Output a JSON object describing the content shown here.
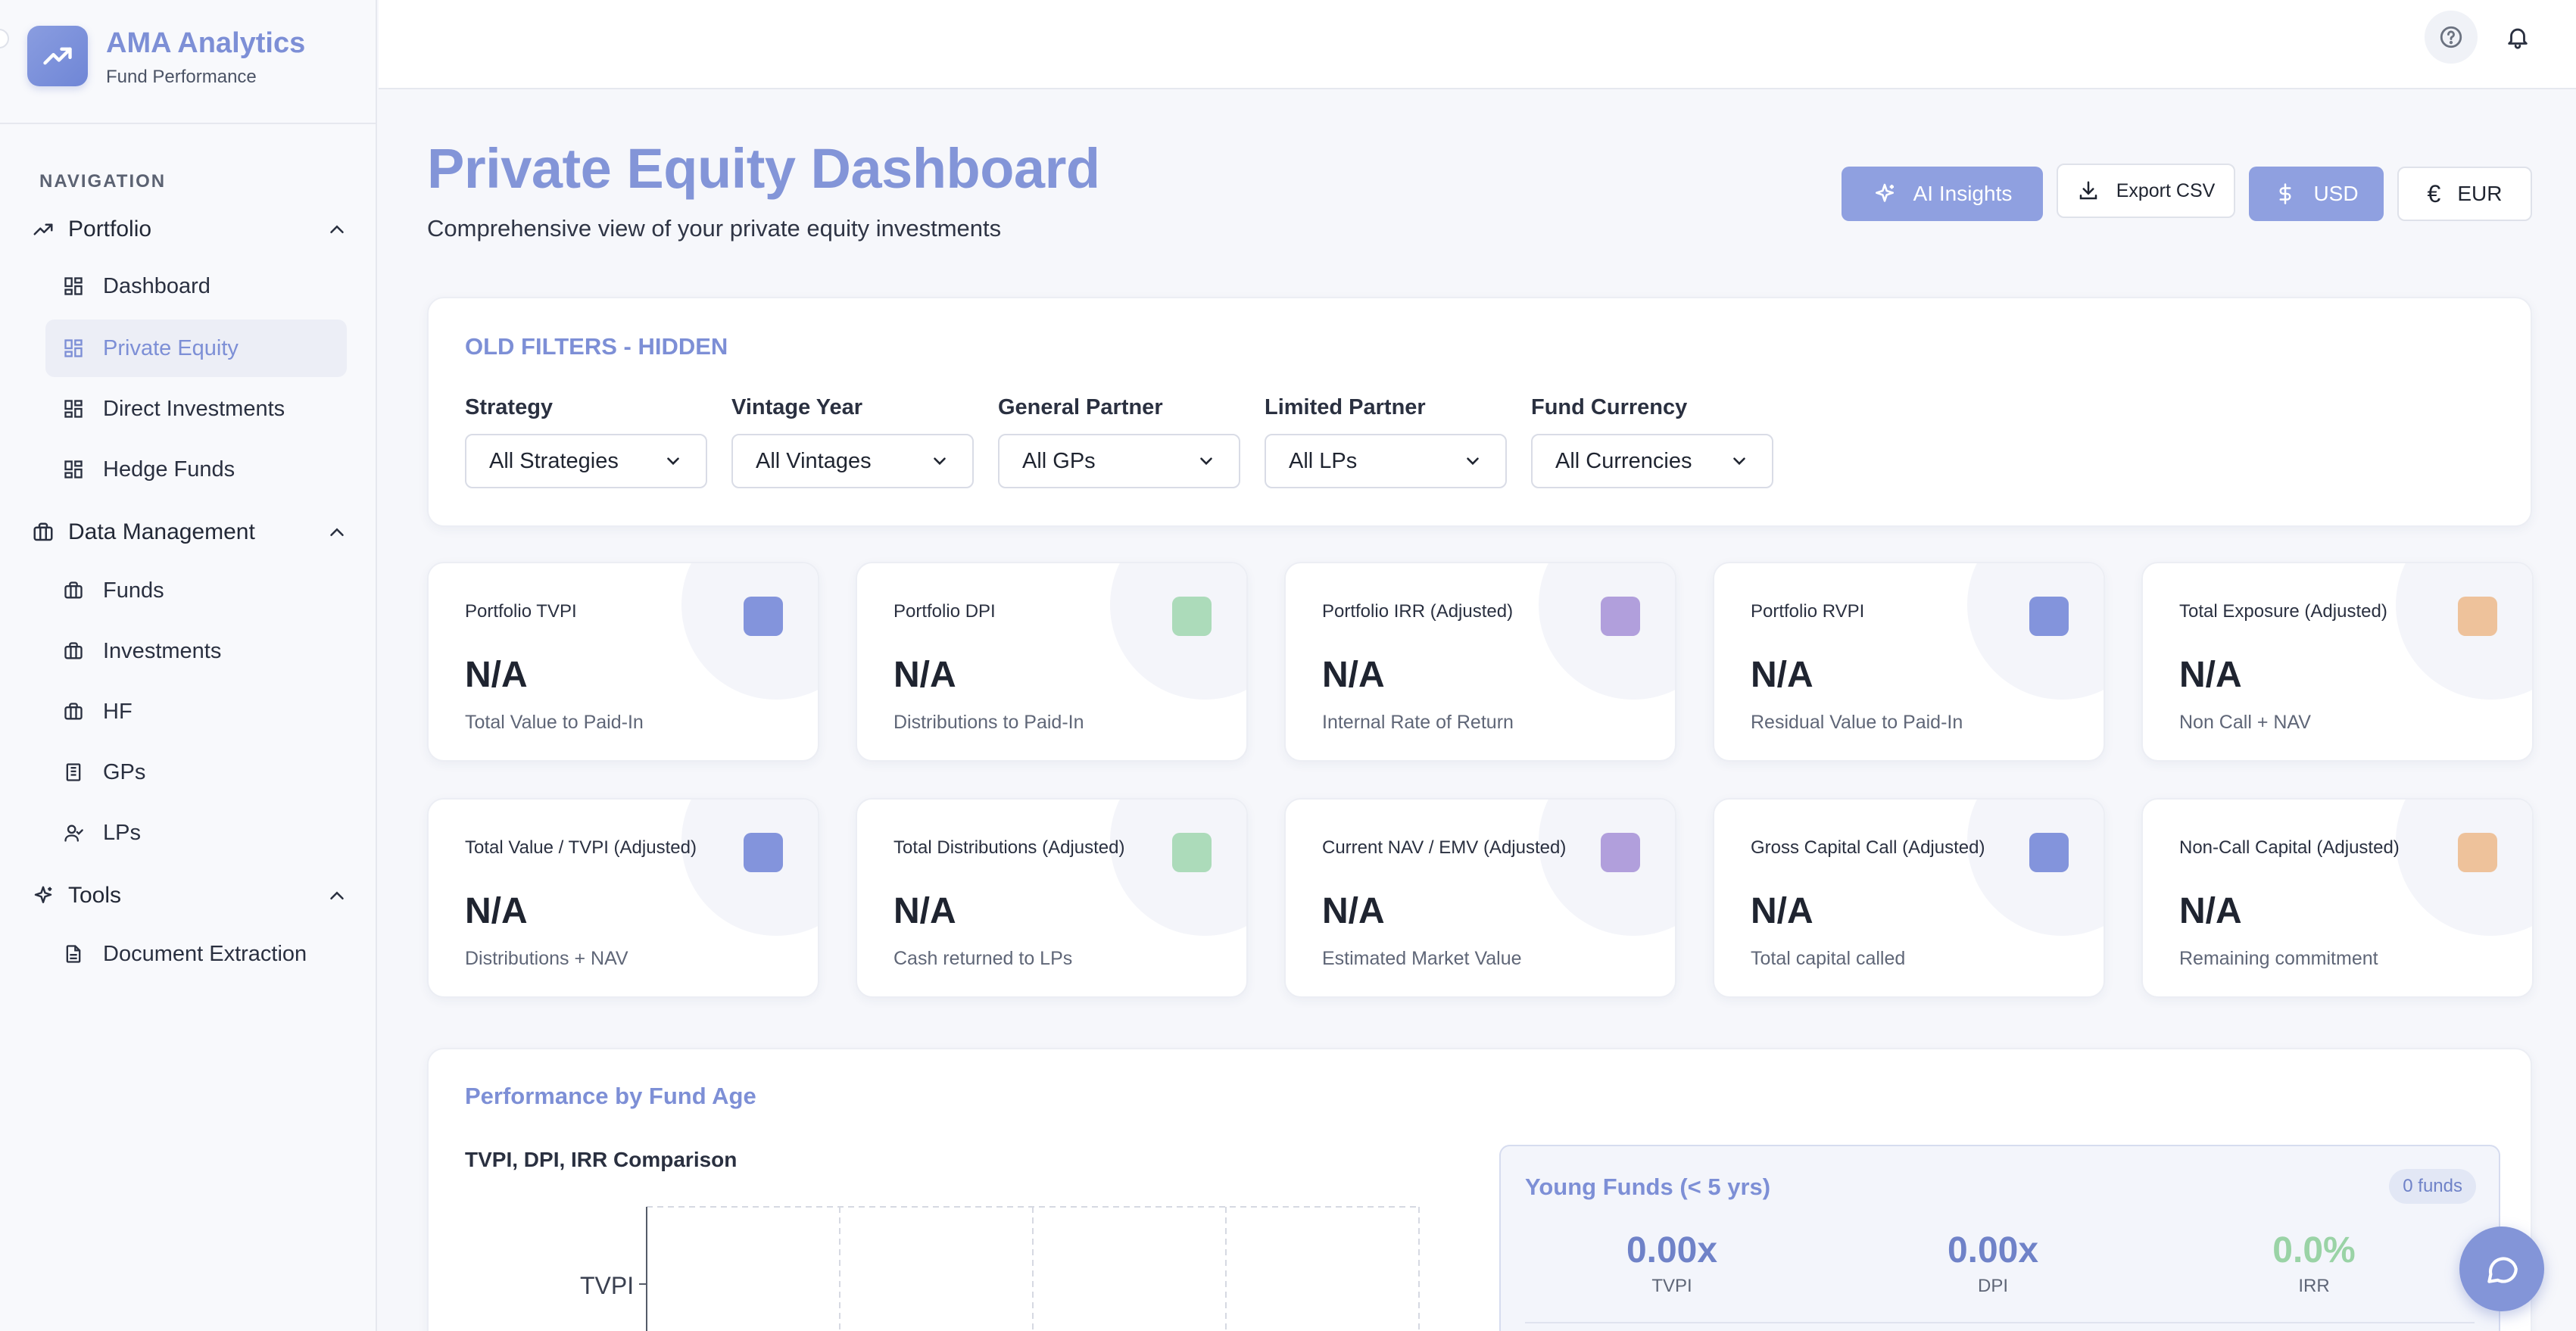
{
  "brand": {
    "title": "AMA Analytics",
    "subtitle": "Fund Performance"
  },
  "sidebar": {
    "nav_heading": "NAVIGATION",
    "groups": [
      {
        "label": "Portfolio",
        "icon": "trending-up-icon",
        "items": [
          {
            "label": "Dashboard",
            "icon": "grid-icon",
            "active": false
          },
          {
            "label": "Private Equity",
            "icon": "grid-icon",
            "active": true
          },
          {
            "label": "Direct Investments",
            "icon": "grid-icon",
            "active": false
          },
          {
            "label": "Hedge Funds",
            "icon": "grid-icon",
            "active": false
          }
        ]
      },
      {
        "label": "Data Management",
        "icon": "briefcase-icon",
        "items": [
          {
            "label": "Funds",
            "icon": "briefcase-icon"
          },
          {
            "label": "Investments",
            "icon": "briefcase-icon"
          },
          {
            "label": "HF",
            "icon": "briefcase-icon"
          },
          {
            "label": "GPs",
            "icon": "building-icon"
          },
          {
            "label": "LPs",
            "icon": "user-check-icon"
          }
        ]
      },
      {
        "label": "Tools",
        "icon": "sparkles-icon",
        "items": [
          {
            "label": "Document Extraction",
            "icon": "file-icon"
          }
        ]
      }
    ]
  },
  "header": {
    "title": "Private Equity Dashboard",
    "subtitle": "Comprehensive view of your private equity investments",
    "ai_label": "AI Insights",
    "export_label": "Export CSV",
    "usd_label": "USD",
    "eur_label": "EUR",
    "eur_symbol": "€"
  },
  "filters": {
    "title": "OLD FILTERS - HIDDEN",
    "items": [
      {
        "label": "Strategy",
        "value": "All Strategies"
      },
      {
        "label": "Vintage Year",
        "value": "All Vintages"
      },
      {
        "label": "General Partner",
        "value": "All GPs"
      },
      {
        "label": "Limited Partner",
        "value": "All LPs"
      },
      {
        "label": "Fund Currency",
        "value": "All Currencies"
      }
    ]
  },
  "metrics": [
    {
      "label": "Portfolio TVPI",
      "value": "N/A",
      "desc": "Total Value to Paid-In",
      "color": "#6f82d6",
      "icon": "trending-up-icon"
    },
    {
      "label": "Portfolio DPI",
      "value": "N/A",
      "desc": "Distributions to Paid-In",
      "color": "#9fd6ae",
      "icon": "dollar-icon"
    },
    {
      "label": "Portfolio IRR (Adjusted)",
      "value": "N/A",
      "desc": "Internal Rate of Return",
      "color": "#a48fd6",
      "icon": "activity-icon"
    },
    {
      "label": "Portfolio RVPI",
      "value": "N/A",
      "desc": "Residual Value to Paid-In",
      "color": "#6f82d6",
      "icon": "briefcase-icon"
    },
    {
      "label": "Total Exposure (Adjusted)",
      "value": "N/A",
      "desc": "Non Call + NAV",
      "color": "#ecb88a",
      "icon": "target-icon"
    },
    {
      "label": "Total Value / TVPI (Adjusted)",
      "value": "N/A",
      "desc": "Distributions + NAV",
      "color": "#6f82d6",
      "icon": "dollar-icon"
    },
    {
      "label": "Total Distributions (Adjusted)",
      "value": "N/A",
      "desc": "Cash returned to LPs",
      "color": "#9fd6ae",
      "icon": "dollar-icon"
    },
    {
      "label": "Current NAV / EMV (Adjusted)",
      "value": "N/A",
      "desc": "Estimated Market Value",
      "color": "#a48fd6",
      "icon": "box-icon"
    },
    {
      "label": "Gross Capital Call (Adjusted)",
      "value": "N/A",
      "desc": "Total capital called",
      "color": "#6f82d6",
      "icon": "arrow-icon"
    },
    {
      "label": "Non-Call Capital (Adjusted)",
      "value": "N/A",
      "desc": "Remaining commitment",
      "color": "#ecb88a",
      "icon": "clock-icon"
    }
  ],
  "performance": {
    "title": "Performance by Fund Age",
    "chart_title": "TVPI, DPI, IRR Comparison",
    "y_tick": "TVPI",
    "young": {
      "title": "Young Funds (< 5 yrs)",
      "badge": "0 funds",
      "stats": [
        {
          "value": "0.00x",
          "label": "TVPI"
        },
        {
          "value": "0.00x",
          "label": "DPI"
        },
        {
          "value": "0.0%",
          "label": "IRR"
        }
      ]
    }
  }
}
